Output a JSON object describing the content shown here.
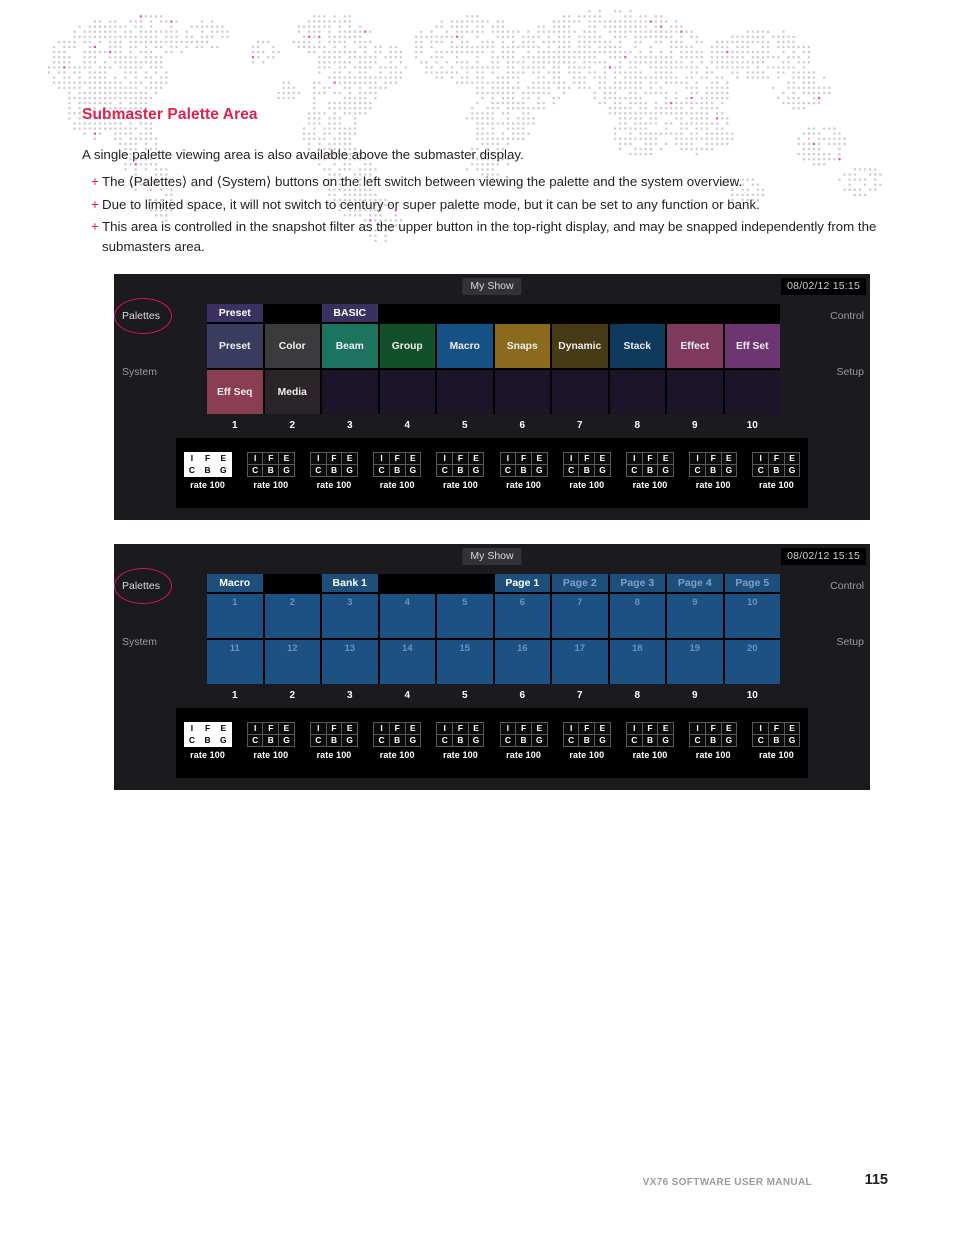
{
  "document": {
    "title": "Submaster Palette Area",
    "intro": "A single palette viewing area is also available above the submaster display.",
    "bullets": [
      "The ⟨Palettes⟩ and ⟨System⟩ buttons on the left switch between viewing the palette and the system overview.",
      "Due to limited space, it will not switch to century or super palette mode, but it can be set to any function or bank.",
      "This area is controlled in the snapshot filter as the upper button in the top-right display, and may be snapped independently from the submasters area."
    ],
    "bullet_marker": "+",
    "footer": {
      "manual": "VX76 SOFTWARE USER MANUAL",
      "page": "115"
    },
    "accent_color": "#e0214b"
  },
  "panel_palette": {
    "show_name": "My Show",
    "clock": "08/02/12  15:15",
    "left_labels": {
      "palettes": "Palettes",
      "system": "System"
    },
    "right_labels": {
      "control": "Control",
      "setup": "Setup"
    },
    "header_buttons": [
      {
        "label": "Preset",
        "col": 1,
        "bg": "#3b3161"
      },
      {
        "label": "BASIC",
        "col": 3,
        "bg": "#3b3161"
      }
    ],
    "palette_row1": [
      {
        "label": "Preset",
        "bg": "#3a3c5f"
      },
      {
        "label": "Color",
        "bg": "#3b3a3c"
      },
      {
        "label": "Beam",
        "bg": "#1c7460"
      },
      {
        "label": "Group",
        "bg": "#12502a"
      },
      {
        "label": "Macro",
        "bg": "#165186"
      },
      {
        "label": "Snaps",
        "bg": "#8a6a1c"
      },
      {
        "label": "Dynamic",
        "bg": "#463a17"
      },
      {
        "label": "Stack",
        "bg": "#10395e"
      },
      {
        "label": "Effect",
        "bg": "#7e3a5c"
      },
      {
        "label": "Eff Set",
        "bg": "#6d3572"
      }
    ],
    "palette_row2": [
      {
        "label": "Eff Seq",
        "bg": "#8b3e53"
      },
      {
        "label": "Media",
        "bg": "#2b2429"
      },
      {
        "label": "",
        "bg": "#1c1529"
      },
      {
        "label": "",
        "bg": "#1c1529"
      },
      {
        "label": "",
        "bg": "#1c1529"
      },
      {
        "label": "",
        "bg": "#1c1529"
      },
      {
        "label": "",
        "bg": "#1c1529"
      },
      {
        "label": "",
        "bg": "#1c1529"
      },
      {
        "label": "",
        "bg": "#1c1529"
      },
      {
        "label": "",
        "bg": "#1c1529"
      }
    ],
    "column_numbers": [
      "1",
      "2",
      "3",
      "4",
      "5",
      "6",
      "7",
      "8",
      "9",
      "10"
    ],
    "submasters": [
      {
        "active": true,
        "rate": "rate 100"
      },
      {
        "active": false,
        "rate": "rate 100"
      },
      {
        "active": false,
        "rate": "rate 100"
      },
      {
        "active": false,
        "rate": "rate 100"
      },
      {
        "active": false,
        "rate": "rate 100"
      },
      {
        "active": false,
        "rate": "rate 100"
      },
      {
        "active": false,
        "rate": "rate 100"
      },
      {
        "active": false,
        "rate": "rate 100"
      },
      {
        "active": false,
        "rate": "rate 100"
      },
      {
        "active": false,
        "rate": "rate 100"
      }
    ],
    "submaster_flags": [
      "I",
      "F",
      "E",
      "C",
      "B",
      "G"
    ]
  },
  "panel_macro": {
    "show_name": "My Show",
    "clock": "08/02/12  15:15",
    "left_labels": {
      "palettes": "Palettes",
      "system": "System"
    },
    "right_labels": {
      "control": "Control",
      "setup": "Setup"
    },
    "header_buttons": [
      {
        "label": "Macro",
        "col": 1,
        "bg": "#1d4e7c",
        "selected": true
      },
      {
        "label": "Bank 1",
        "col": 3,
        "bg": "#1d4e7c",
        "selected": true
      },
      {
        "label": "Page 1",
        "col": 6,
        "bg": "#1d4e7c",
        "selected": true
      },
      {
        "label": "Page 2",
        "col": 7,
        "bg": "#1d4e7c",
        "selected": false
      },
      {
        "label": "Page 3",
        "col": 8,
        "bg": "#1d4e7c",
        "selected": false
      },
      {
        "label": "Page 4",
        "col": 9,
        "bg": "#1d4e7c",
        "selected": false
      },
      {
        "label": "Page 5",
        "col": 10,
        "bg": "#1d4e7c",
        "selected": false
      }
    ],
    "macro_row1": [
      "1",
      "2",
      "3",
      "4",
      "5",
      "6",
      "7",
      "8",
      "9",
      "10"
    ],
    "macro_row2": [
      "11",
      "12",
      "13",
      "14",
      "15",
      "16",
      "17",
      "18",
      "19",
      "20"
    ],
    "macro_cell_bg": "#1d5183",
    "column_numbers": [
      "1",
      "2",
      "3",
      "4",
      "5",
      "6",
      "7",
      "8",
      "9",
      "10"
    ],
    "submasters": [
      {
        "active": true,
        "rate": "rate 100"
      },
      {
        "active": false,
        "rate": "rate 100"
      },
      {
        "active": false,
        "rate": "rate 100"
      },
      {
        "active": false,
        "rate": "rate 100"
      },
      {
        "active": false,
        "rate": "rate 100"
      },
      {
        "active": false,
        "rate": "rate 100"
      },
      {
        "active": false,
        "rate": "rate 100"
      },
      {
        "active": false,
        "rate": "rate 100"
      },
      {
        "active": false,
        "rate": "rate 100"
      },
      {
        "active": false,
        "rate": "rate 100"
      }
    ],
    "submaster_flags": [
      "I",
      "F",
      "E",
      "C",
      "B",
      "G"
    ]
  }
}
